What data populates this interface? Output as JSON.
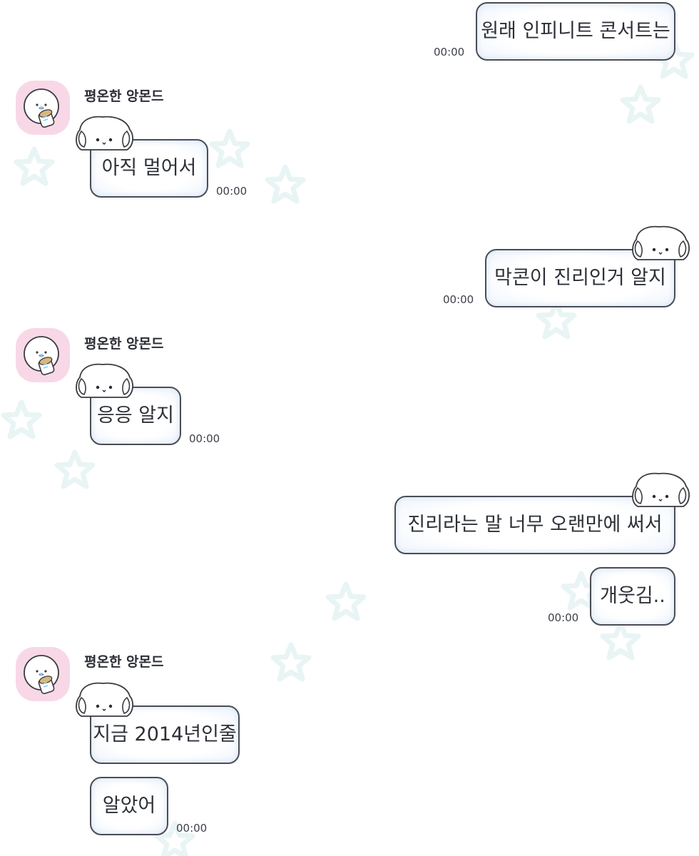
{
  "chat": {
    "partner_name": "평온한 앙몬드",
    "messages": [
      {
        "side": "right",
        "text": "원래 인피니트 콘서트는",
        "time": "00:00"
      },
      {
        "side": "left",
        "text": "아직 멀어서",
        "time": "00:00"
      },
      {
        "side": "right",
        "text": "막콘이 진리인거 알지",
        "time": "00:00"
      },
      {
        "side": "left",
        "text": "응응 알지",
        "time": "00:00"
      },
      {
        "side": "right",
        "text": "진리라는 말 너무 오랜만에 써서",
        "time": ""
      },
      {
        "side": "right",
        "text": "개웃김..",
        "time": "00:00"
      },
      {
        "side": "left",
        "text": "지금 2014년인줄",
        "time": ""
      },
      {
        "side": "left",
        "text": "알았어",
        "time": "00:00"
      }
    ]
  },
  "icons": {
    "avatar": "smiling-ghost-holding-cup-icon",
    "bubble_decoration": "peeking-puppy-icon",
    "background": "star-outline-icon"
  },
  "colors": {
    "avatar_background": "#f8d8e6",
    "bubble_border": "#4a4d55",
    "bubble_fill": "#ffffff",
    "bubble_inner_glow": "#eef4fc",
    "background_star": "#e9f4f4"
  }
}
